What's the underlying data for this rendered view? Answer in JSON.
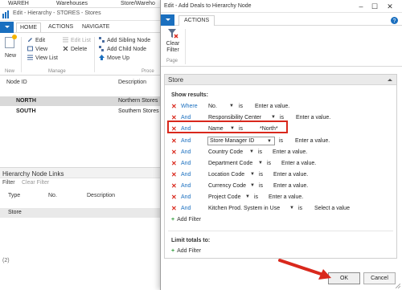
{
  "background": {
    "topbar": [
      "WAREH",
      "Warehouses",
      "Store/Wareho"
    ],
    "window_title": "Edit - Hierarchy - STORES - Stores",
    "tabs": [
      "HOME",
      "ACTIONS",
      "NAVIGATE"
    ],
    "ribbon": {
      "new": "New",
      "edit": "Edit",
      "view": "View",
      "view_list": "View List",
      "edit_list": "Edit List",
      "delete": "Delete",
      "add_sibling": "Add Sibling Node",
      "add_child": "Add Child Node",
      "move_up": "Move Up",
      "group_new": "New",
      "group_manage": "Manage",
      "group_process": "Proce"
    },
    "list_columns": [
      "Node ID",
      "Description"
    ],
    "list_rows": [
      {
        "id": "NORTH",
        "desc": "Northern Stores"
      },
      {
        "id": "SOUTH",
        "desc": "Southern Stores"
      }
    ],
    "links_title": "Hierarchy Node Links",
    "filter_label": "Filter",
    "clear_filter": "Clear Filter",
    "links_columns": [
      "Type",
      "No.",
      "Description"
    ],
    "links_row": "Store",
    "status": "(2)"
  },
  "dialog": {
    "title": "Edit - Add Deals to Hierarchy Node",
    "tab": "ACTIONS",
    "clear_filter": "Clear\nFilter",
    "clear_filter_l1": "Clear",
    "clear_filter_l2": "Filter",
    "group_page": "Page",
    "panel_title": "Store",
    "show_results": "Show results:",
    "filters": [
      {
        "op": "Where",
        "field": "No.",
        "is": "is",
        "value": "Enter a value."
      },
      {
        "op": "And",
        "field": "Responsibility Center",
        "is": "is",
        "value": "Enter a value."
      },
      {
        "op": "And",
        "field": "Name",
        "is": "is",
        "value": "*North*"
      },
      {
        "op": "And",
        "field": "Store Manager ID",
        "is": "is",
        "value": "Enter a value."
      },
      {
        "op": "And",
        "field": "Country Code",
        "is": "is",
        "value": "Enter a value."
      },
      {
        "op": "And",
        "field": "Department Code",
        "is": "is",
        "value": "Enter a value."
      },
      {
        "op": "And",
        "field": "Location Code",
        "is": "is",
        "value": "Enter a value."
      },
      {
        "op": "And",
        "field": "Currency Code",
        "is": "is",
        "value": "Enter a value."
      },
      {
        "op": "And",
        "field": "Project Code",
        "is": "is",
        "value": "Enter a value."
      },
      {
        "op": "And",
        "field": "Kitchen Prod. System in Use",
        "is": "is",
        "value": "Select a value"
      }
    ],
    "add_filter": "Add Filter",
    "limit_totals": "Limit totals to:",
    "ok": "OK",
    "cancel": "Cancel"
  },
  "colors": {
    "accent_blue": "#1a6fbf",
    "remove_red": "#d9281c",
    "add_green": "#2e9b3a",
    "highlight_red": "#d9281c"
  },
  "icons": [
    "logo-icon",
    "new-icon",
    "edit-icon",
    "view-icon",
    "view-list-icon",
    "edit-list-icon",
    "delete-icon",
    "add-sibling-icon",
    "add-child-icon",
    "move-up-icon",
    "clear-filter-icon",
    "remove-x-icon",
    "plus-icon",
    "help-icon",
    "close-icon",
    "chevron-down-icon"
  ]
}
